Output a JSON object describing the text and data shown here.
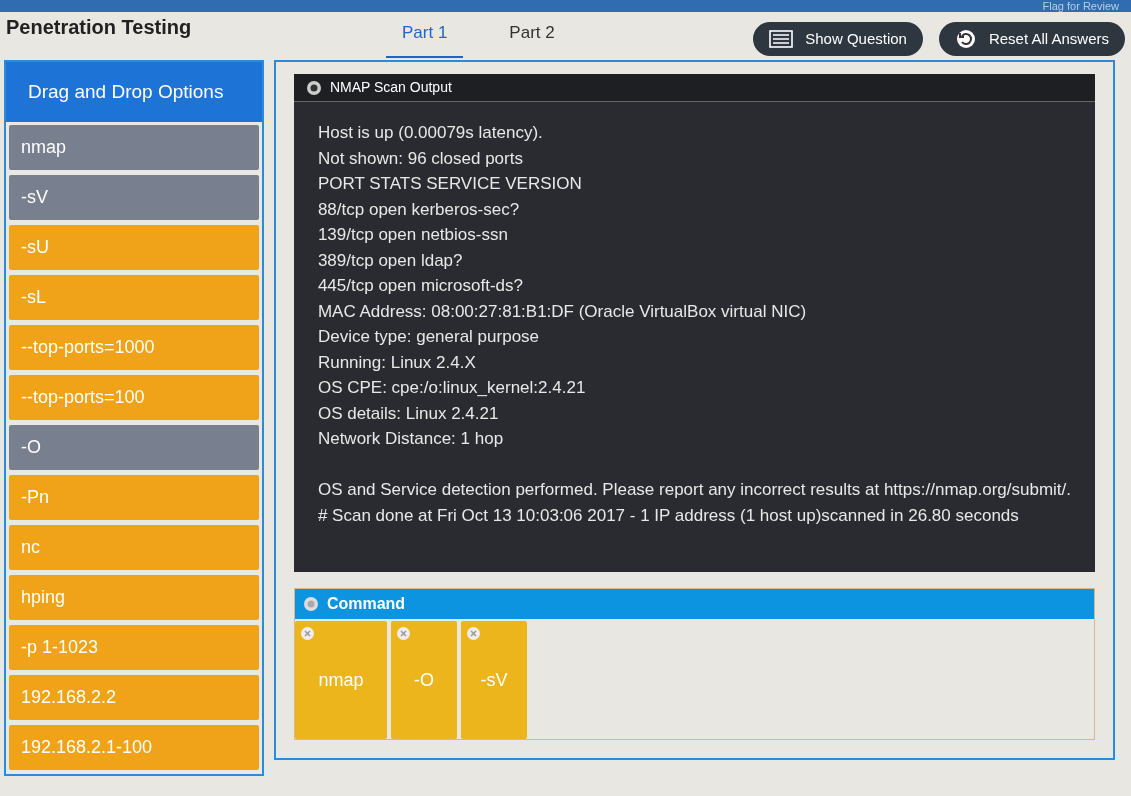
{
  "header": {
    "title": "Penetration Testing",
    "flag": "Flag for Review"
  },
  "tabs": [
    {
      "label": "Part 1",
      "selected": true
    },
    {
      "label": "Part 2",
      "selected": false
    }
  ],
  "buttons": [
    {
      "kind": "question",
      "label": "Show Question"
    },
    {
      "kind": "reset",
      "label": "Reset All Answers"
    }
  ],
  "options": {
    "title": "Drag and Drop Options",
    "items": [
      {
        "label": "nmap",
        "used": true
      },
      {
        "label": "-sV",
        "used": true
      },
      {
        "label": "-sU",
        "used": false
      },
      {
        "label": "-sL",
        "used": false
      },
      {
        "label": "--top-ports=1000",
        "used": false
      },
      {
        "label": "--top-ports=100",
        "used": false
      },
      {
        "label": "-O",
        "used": true
      },
      {
        "label": "-Pn",
        "used": false
      },
      {
        "label": "nc",
        "used": false
      },
      {
        "label": "hping",
        "used": false
      },
      {
        "label": "-p 1-1023",
        "used": false
      },
      {
        "label": "192.168.2.2",
        "used": false
      },
      {
        "label": "192.168.2.1-100",
        "used": false
      }
    ]
  },
  "output": {
    "title": "NMAP Scan Output",
    "lines": [
      "Host is up (0.00079s latency).",
      "Not shown: 96 closed ports",
      "PORT STATS SERVICE VERSION",
      "88/tcp open kerberos-sec?",
      "139/tcp open netbios-ssn",
      "389/tcp open ldap?",
      "445/tcp open microsoft-ds?",
      "MAC Address: 08:00:27:81:B1:DF (Oracle VirtualBox virtual NIC)",
      "Device type: general purpose",
      "Running: Linux 2.4.X",
      "OS CPE: cpe:/o:linux_kernel:2.4.21",
      "OS details: Linux 2.4.21",
      "Network Distance: 1 hop"
    ],
    "summary": [
      "OS and Service detection performed. Please report any incorrect results at https://nmap.org/submit/.",
      "# Scan done at Fri Oct 13 10:03:06 2017 - 1 IP address (1 host up)scanned in 26.80 seconds"
    ]
  },
  "command": {
    "title": "Command",
    "items": [
      "nmap",
      "-O",
      "-sV"
    ]
  }
}
